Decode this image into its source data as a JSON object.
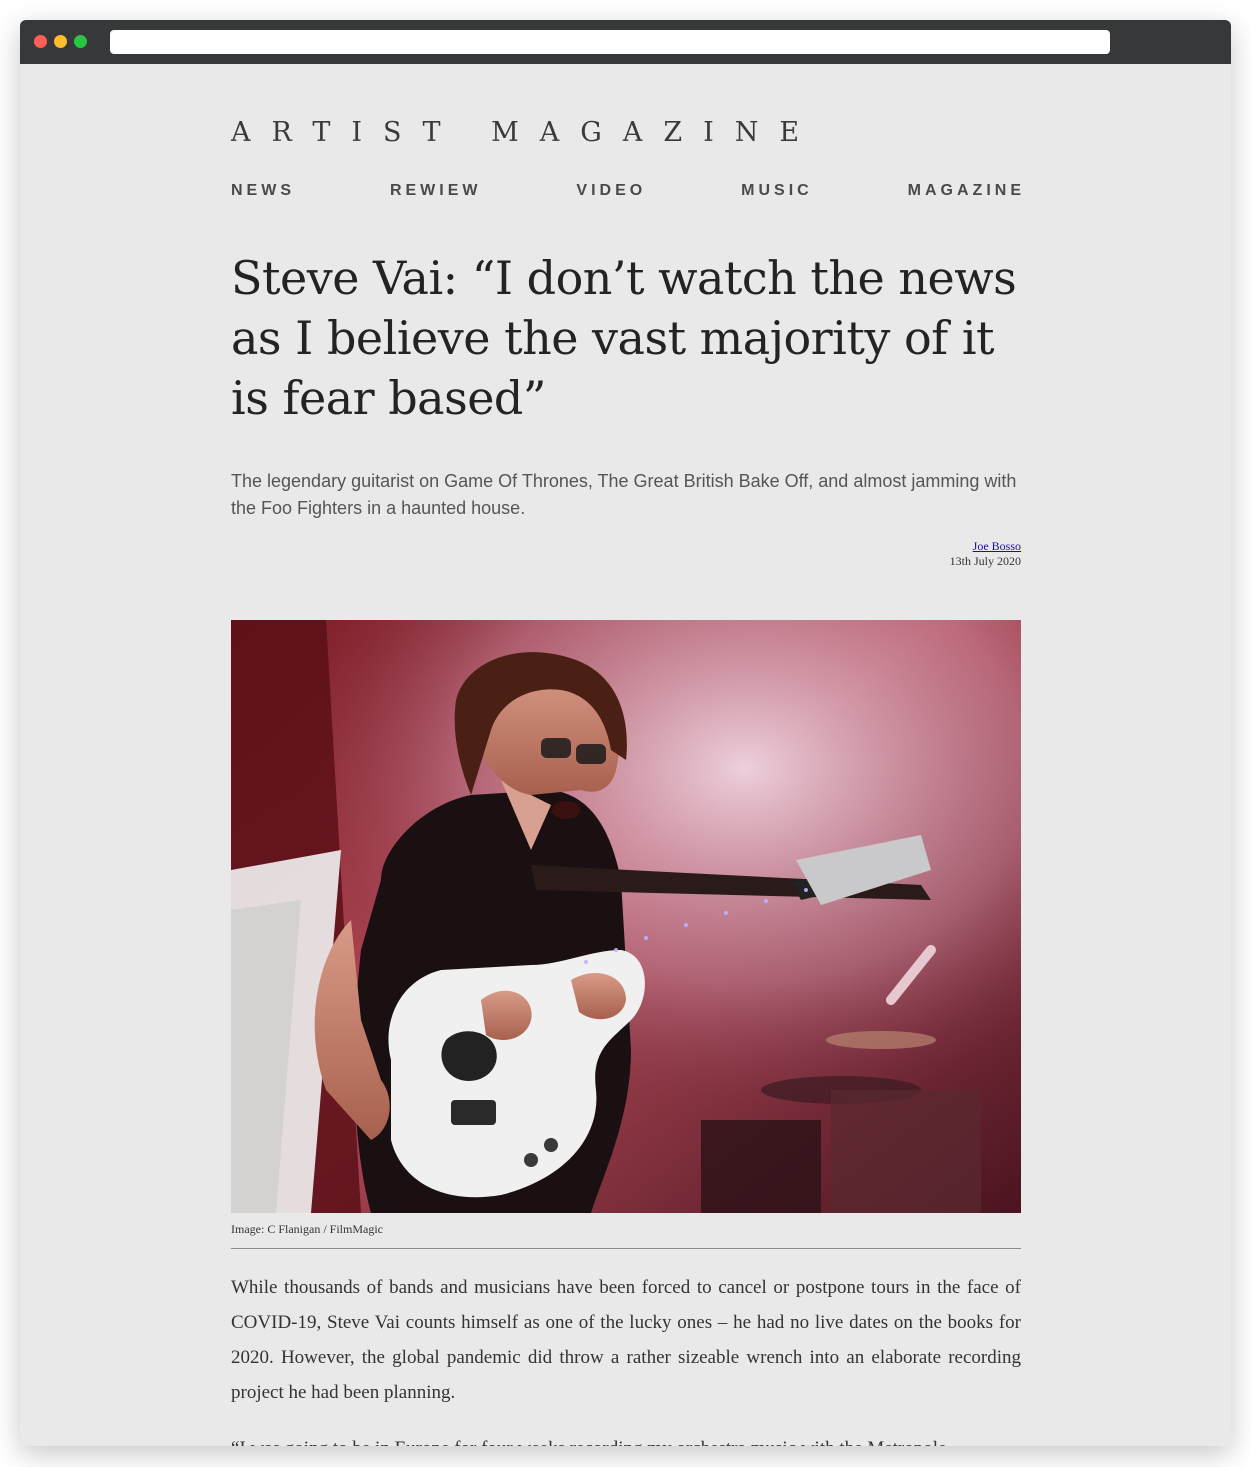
{
  "brand": {
    "name": "ARTIST MAGAZINE"
  },
  "nav": {
    "items": [
      "NEWS",
      "REWIEW",
      "VIDEO",
      "MUSIC",
      "MAGAZINE"
    ]
  },
  "article": {
    "headline": "Steve Vai: “I don’t watch the news as I believe the vast majority of it is fear based”",
    "standfirst": "The legendary guitarist on Game Of Thrones, The Great British Bake Off, and almost jamming with the Foo Fighters in a haunted house.",
    "author": "Joe Bosso",
    "date": "13th July 2020",
    "image": {
      "description_icon": "guitarist-photo",
      "caption": "Image: C Flanigan / FilmMagic"
    },
    "paragraphs": [
      "While thousands of bands and musicians have been forced to cancel or postpone tours in the face of COVID-19, Steve Vai counts himself as one of the lucky ones – he had no live dates on the books for 2020. However, the global pandemic did throw a rather sizeable wrench into an elaborate recording project he had been planning.",
      "“I was going to be in Europe for four weeks recording my orchestra music with the Metropole"
    ]
  },
  "colors": {
    "background": "#e9e9e9",
    "titlebar": "#37383a",
    "link": "#1a0dab"
  }
}
